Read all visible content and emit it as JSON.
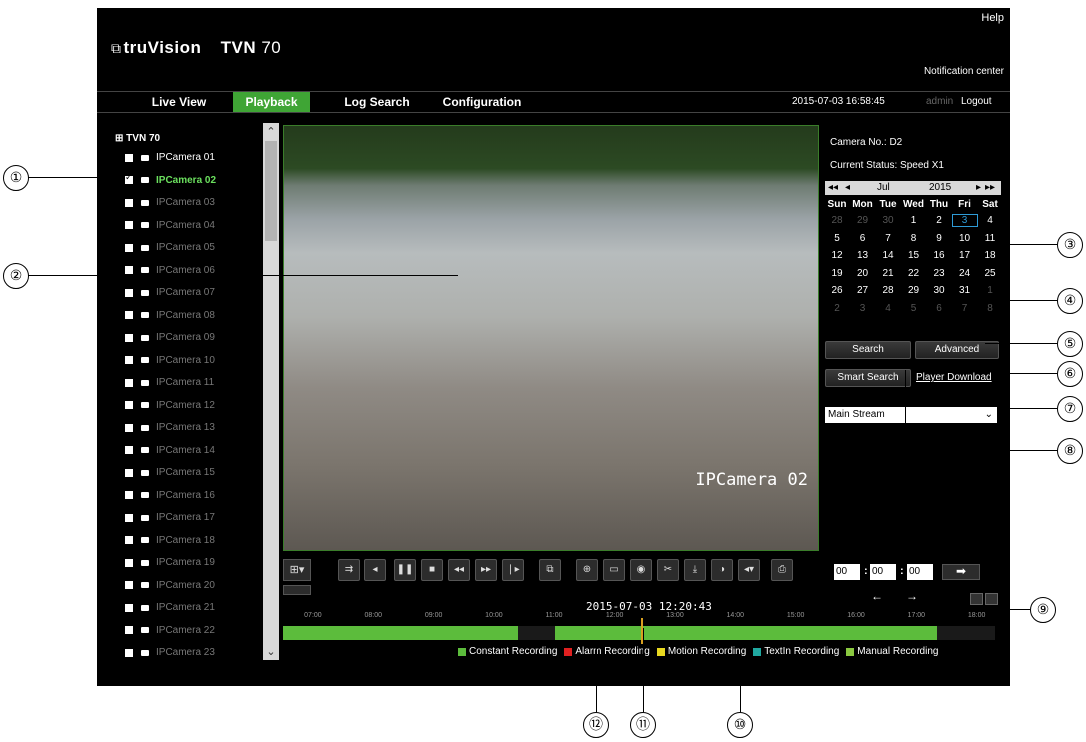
{
  "header": {
    "help": "Help",
    "logo_brand": "truVision",
    "logo_model": "TVN",
    "logo_number": "70",
    "notification": "Notification center"
  },
  "nav": {
    "items": [
      "Live View",
      "Playback",
      "Log Search",
      "Configuration"
    ],
    "active": "Playback",
    "datetime": "2015-07-03 16:58:45",
    "user": "admin",
    "logout": "Logout"
  },
  "camera_tree": {
    "root": "TVN 70",
    "cameras": [
      {
        "label": "IPCamera 01",
        "checked": false
      },
      {
        "label": "IPCamera 02",
        "checked": true
      },
      {
        "label": "IPCamera 03",
        "checked": false
      },
      {
        "label": "IPCamera 04",
        "checked": false
      },
      {
        "label": "IPCamera 05",
        "checked": false
      },
      {
        "label": "IPCamera 06",
        "checked": false
      },
      {
        "label": "IPCamera 07",
        "checked": false
      },
      {
        "label": "IPCamera 08",
        "checked": false
      },
      {
        "label": "IPCamera 09",
        "checked": false
      },
      {
        "label": "IPCamera 10",
        "checked": false
      },
      {
        "label": "IPCamera 11",
        "checked": false
      },
      {
        "label": "IPCamera 12",
        "checked": false
      },
      {
        "label": "IPCamera 13",
        "checked": false
      },
      {
        "label": "IPCamera 14",
        "checked": false
      },
      {
        "label": "IPCamera 15",
        "checked": false
      },
      {
        "label": "IPCamera 16",
        "checked": false
      },
      {
        "label": "IPCamera 17",
        "checked": false
      },
      {
        "label": "IPCamera 18",
        "checked": false
      },
      {
        "label": "IPCamera 19",
        "checked": false
      },
      {
        "label": "IPCamera 20",
        "checked": false
      },
      {
        "label": "IPCamera 21",
        "checked": false
      },
      {
        "label": "IPCamera 22",
        "checked": false
      },
      {
        "label": "IPCamera 23",
        "checked": false
      }
    ]
  },
  "video": {
    "overlay": "IPCamera 02"
  },
  "right_panel": {
    "camera_no": "Camera No.: D2",
    "status": "Current Status: Speed X1",
    "calendar": {
      "month": "Jul",
      "year": "2015",
      "weekdays": [
        "Sun",
        "Mon",
        "Tue",
        "Wed",
        "Thu",
        "Fri",
        "Sat"
      ],
      "days": [
        [
          "28",
          "29",
          "30",
          "1",
          "2",
          "3",
          "4"
        ],
        [
          "5",
          "6",
          "7",
          "8",
          "9",
          "10",
          "11"
        ],
        [
          "12",
          "13",
          "14",
          "15",
          "16",
          "17",
          "18"
        ],
        [
          "19",
          "20",
          "21",
          "22",
          "23",
          "24",
          "25"
        ],
        [
          "26",
          "27",
          "28",
          "29",
          "30",
          "31",
          "1"
        ],
        [
          "2",
          "3",
          "4",
          "5",
          "6",
          "7",
          "8"
        ]
      ],
      "selected": "3"
    },
    "search": "Search",
    "advanced": "Advanced",
    "smart_search": "Smart Search",
    "player_download": "Player Download",
    "stream": "Main Stream",
    "time_h": "00",
    "time_m": "00",
    "time_s": "00"
  },
  "timeline": {
    "current": "2015-07-03 12:20:43",
    "hours": [
      "07:00",
      "08:00",
      "09:00",
      "10:00",
      "11:00",
      "12:00",
      "13:00",
      "14:00",
      "15:00",
      "16:00",
      "17:00",
      "18:00"
    ],
    "recorded_segments": [
      {
        "start": "07:00",
        "end": "10:24"
      },
      {
        "start": "11:00",
        "end": "17:20"
      }
    ],
    "legend": [
      {
        "label": "Constant Recording",
        "color": "#5cbc3c"
      },
      {
        "label": "Alarm Recording",
        "color": "#e02020"
      },
      {
        "label": "Motion Recording",
        "color": "#e8d820"
      },
      {
        "label": "TextIn Recording",
        "color": "#20a8a0"
      },
      {
        "label": "Manual Recording",
        "color": "#8ac840"
      }
    ]
  },
  "controls": [
    "stream-switch-icon",
    "step-back-icon",
    "pause-icon",
    "stop-icon",
    "rewind-icon",
    "fast-forward-icon",
    "step-forward-icon",
    "window-icon",
    "zoom-icon",
    "capture-picture-icon",
    "snapshot-icon",
    "clip-icon",
    "download-icon",
    "lock-icon",
    "volume-icon",
    "print-icon"
  ],
  "callouts": [
    "①",
    "②",
    "③",
    "④",
    "⑤",
    "⑥",
    "⑦",
    "⑧",
    "⑨",
    "⑩",
    "⑪",
    "⑫"
  ]
}
